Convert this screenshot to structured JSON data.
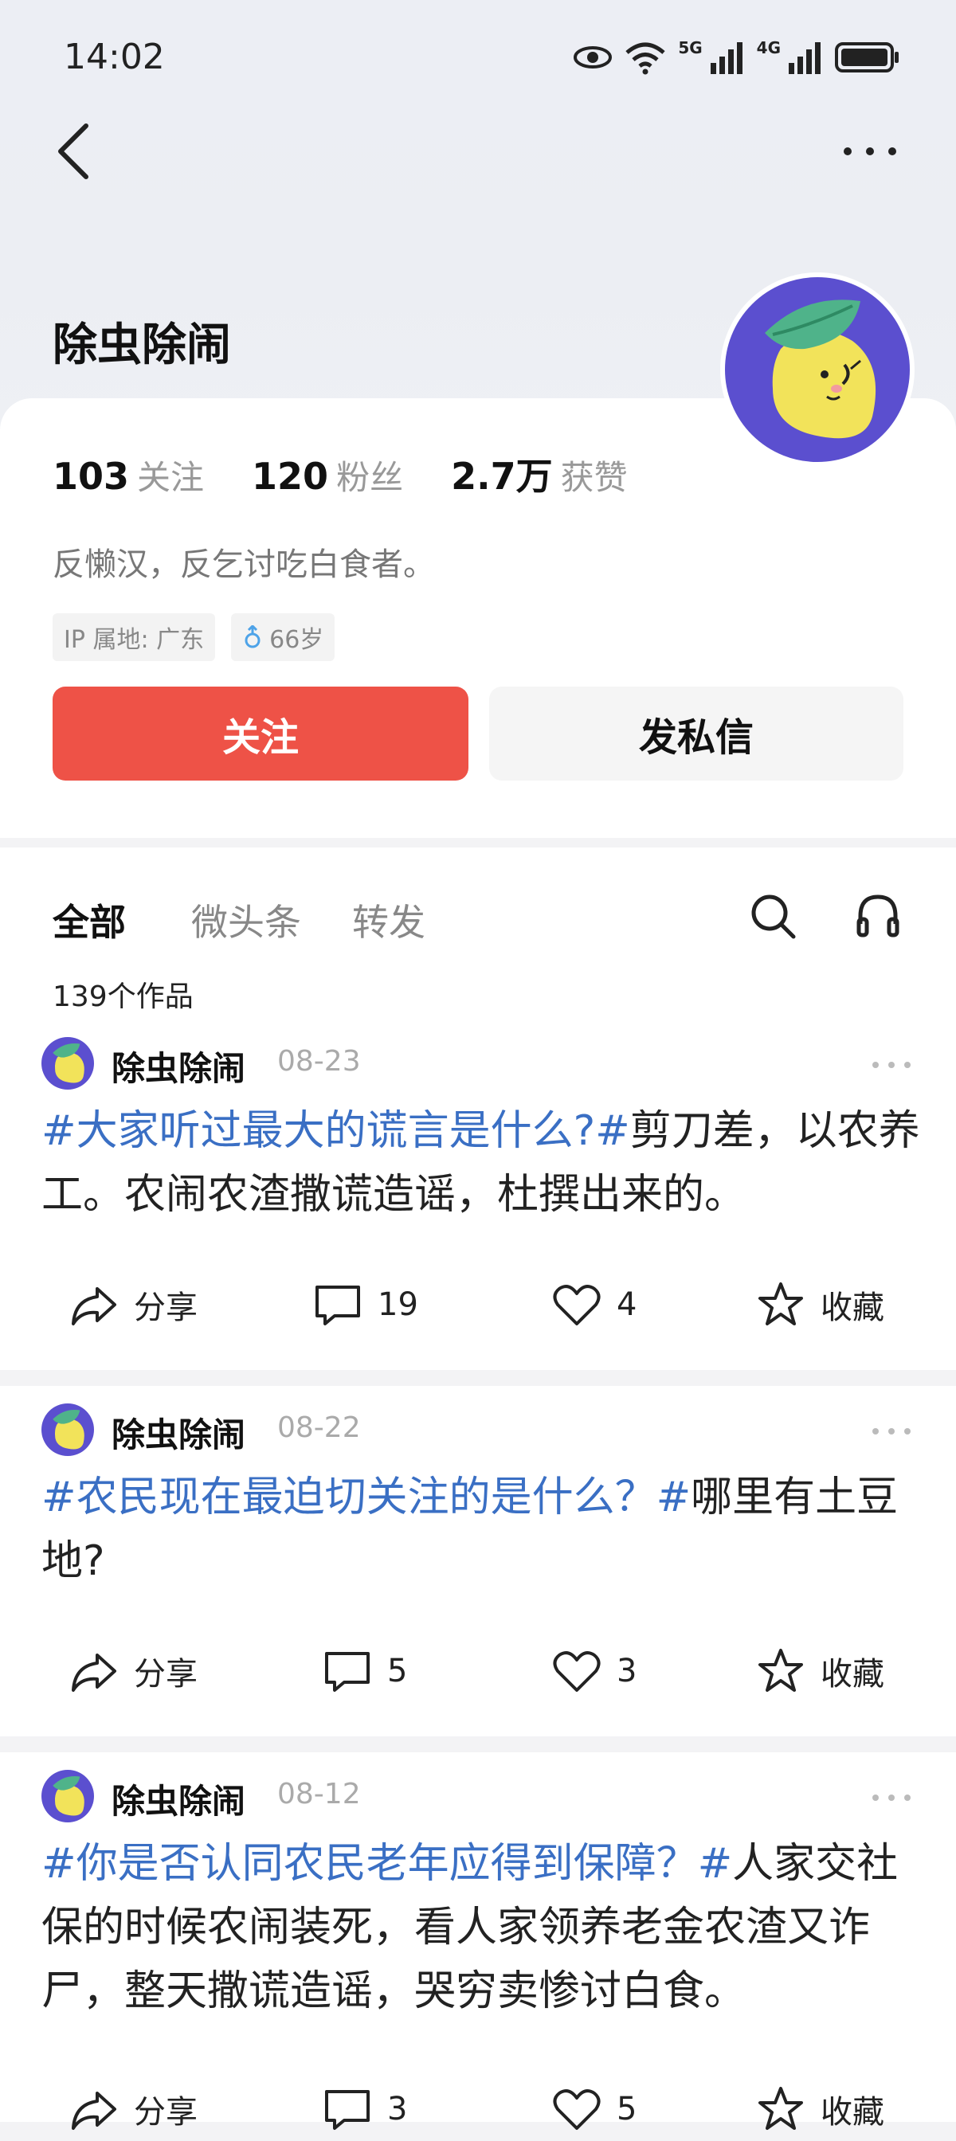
{
  "status_bar": {
    "time": "14:02",
    "net1": "5G",
    "net2": "4G"
  },
  "profile": {
    "name": "除虫除闹",
    "stats": [
      {
        "num": "103",
        "label": "关注"
      },
      {
        "num": "120",
        "label": "粉丝"
      },
      {
        "num": "2.7万",
        "label": "获赞"
      }
    ],
    "bio": "反懒汉，反乞讨吃白食者。",
    "tags": {
      "ip": "IP 属地: 广东",
      "age": "66岁"
    },
    "buttons": {
      "follow": "关注",
      "message": "发私信"
    }
  },
  "feed": {
    "tabs": [
      "全部",
      "微头条",
      "转发"
    ],
    "count": "139个作品"
  },
  "actions": {
    "share": "分享",
    "favorite": "收藏"
  },
  "posts": [
    {
      "author": "除虫除闹",
      "date": "08-23",
      "topic": "#大家听过最大的谎言是什么?#",
      "text": "剪刀差，以农养工。农闹农渣撒谎造谣，杜撰出来的。",
      "comments": "19",
      "likes": "4"
    },
    {
      "author": "除虫除闹",
      "date": "08-22",
      "topic": "#农民现在最迫切关注的是什么？#",
      "text": "哪里有土豆地?",
      "comments": "5",
      "likes": "3"
    },
    {
      "author": "除虫除闹",
      "date": "08-12",
      "topic": "#你是否认同农民老年应得到保障？#",
      "text": "人家交社保的时候农闹装死，看人家领养老金农渣又诈尸，整天撒谎造谣，哭穷卖惨讨白食。",
      "comments": "3",
      "likes": "5"
    }
  ]
}
